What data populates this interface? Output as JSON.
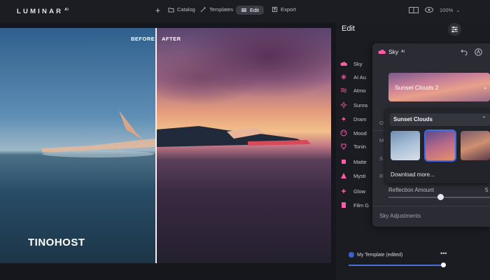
{
  "app": {
    "brand": "LUMINAR",
    "brand_suffix": "AI"
  },
  "topbar": {
    "add_label": "+",
    "catalog": "Catalog",
    "templates": "Templates",
    "edit": "Edit",
    "export": "Export",
    "zoom": "100%"
  },
  "canvas": {
    "before_label": "BEFORE",
    "after_label": "AFTER",
    "watermark": "TINOHOST"
  },
  "edit_panel": {
    "title": "Edit",
    "tools": [
      {
        "label": "Sky",
        "icon": "cloud-icon"
      },
      {
        "label": "AI Au",
        "icon": "sparkle-icon"
      },
      {
        "label": "Atmo",
        "icon": "waves-icon"
      },
      {
        "label": "Sunra",
        "icon": "sun-icon"
      },
      {
        "label": "Dram",
        "icon": "lightning-icon"
      },
      {
        "label": "Mood",
        "icon": "theater-icon"
      },
      {
        "label": "Tonin",
        "icon": "palette-icon"
      },
      {
        "label": "Matte",
        "icon": "square-icon"
      },
      {
        "label": "Mysti",
        "icon": "triangle-icon"
      },
      {
        "label": "Glow",
        "icon": "glow-icon"
      },
      {
        "label": "Film G",
        "icon": "film-icon"
      }
    ],
    "template_name": "My Template (edited)",
    "template_more": "•••"
  },
  "sky_panel": {
    "title": "Sky",
    "title_suffix": "AI",
    "selected_preset": "Sunset Clouds 2",
    "category": "Sunset Clouds",
    "download_more": "Download more...",
    "reflection_label": "Reflection Amount",
    "reflection_value": "5",
    "sky_adjustments": "Sky Adjustments",
    "edge_letters": [
      "O",
      "M",
      "S",
      "R"
    ]
  },
  "colors": {
    "accent": "#4a70d8",
    "panel": "#2b2c33"
  }
}
